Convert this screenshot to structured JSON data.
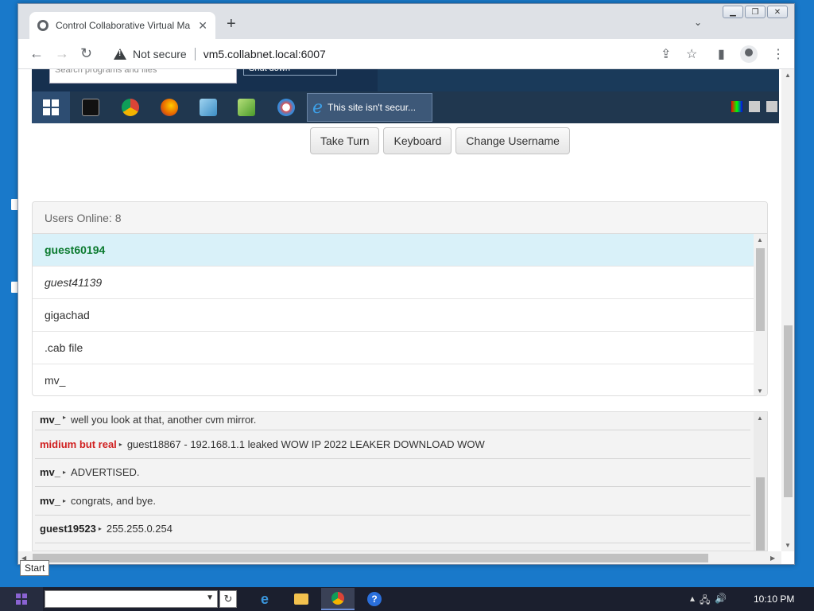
{
  "browser": {
    "tab_title": "Control Collaborative Virtual Ma",
    "not_secure_label": "Not secure",
    "url": "vm5.collabnet.local:6007"
  },
  "vm": {
    "startmenu_search_placeholder": "Search programs and files",
    "shutdown_label": "Shut down",
    "ie_button_label": "This site isn't secur..."
  },
  "controls": {
    "take_turn": "Take Turn",
    "keyboard": "Keyboard",
    "change_username": "Change Username"
  },
  "users": {
    "header": "Users Online: 8",
    "items": [
      "guest60194",
      "guest41139",
      "gigachad",
      ".cab file",
      "mv_"
    ]
  },
  "chat": {
    "messages": [
      {
        "user": "mv_",
        "text": "well you look at that, another cvm mirror."
      },
      {
        "user": "midium but real",
        "text": "guest18867 - 192.168.1.1 leaked WOW IP 2022 LEAKER DOWNLOAD WOW"
      },
      {
        "user": "mv_",
        "text": "ADVERTISED."
      },
      {
        "user": "mv_",
        "text": "congrats, and bye."
      },
      {
        "user": "guest19523",
        "text": "255.255.0.254"
      }
    ]
  },
  "tooltip": "Start",
  "taskbar": {
    "clock": "10:10 PM"
  },
  "colors": {
    "desktop_bg": "#1979ca",
    "active_user_bg": "#d9f1f9",
    "active_user_text": "#0b7a2f",
    "highlight_user": "#d02020"
  }
}
